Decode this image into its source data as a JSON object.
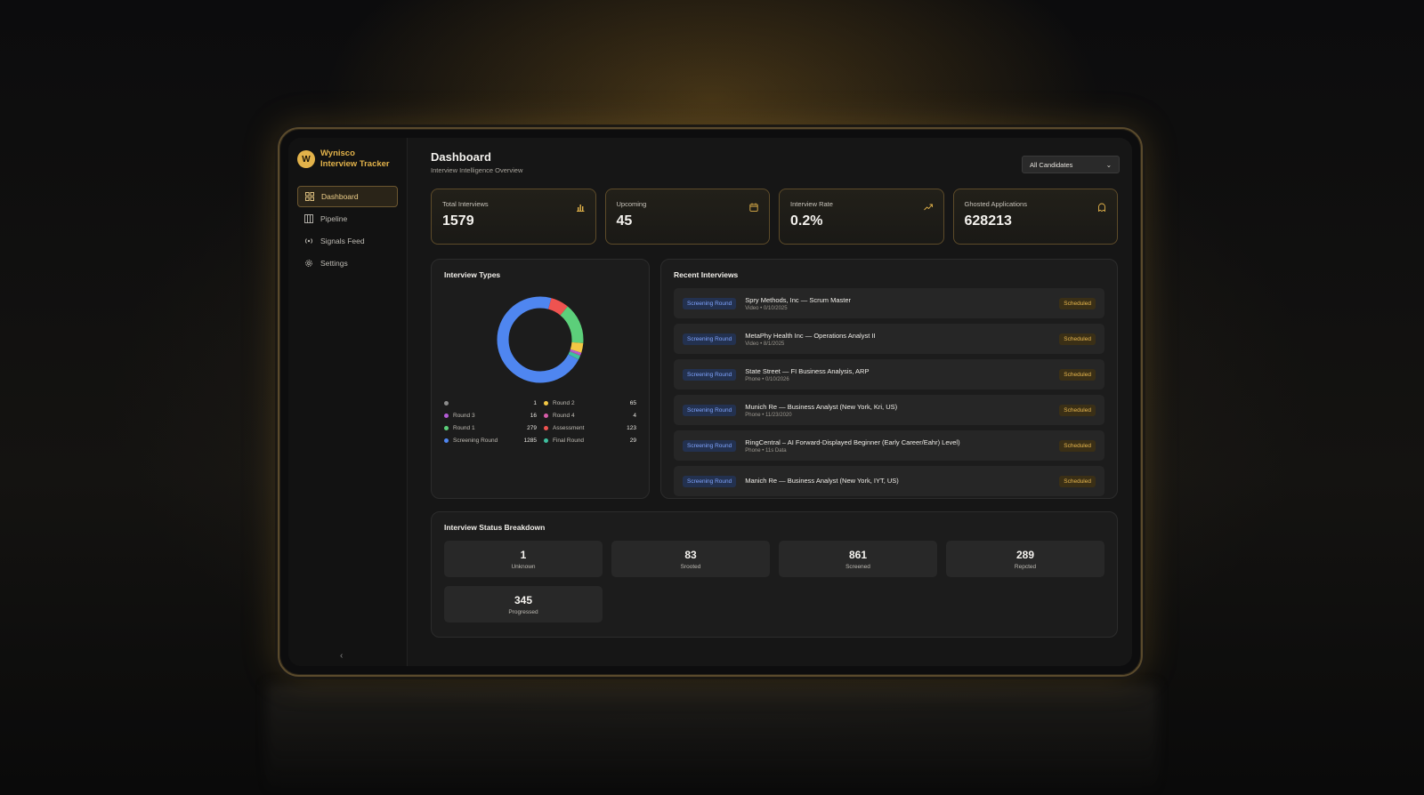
{
  "app": {
    "logo_letter": "W",
    "brand_line1": "Wynisco",
    "brand_line2": "Interview Tracker",
    "accent_color": "#e2b24a"
  },
  "sidebar": {
    "items": [
      {
        "label": "Dashboard",
        "icon": "grid-icon",
        "active": true
      },
      {
        "label": "Pipeline",
        "icon": "columns-icon",
        "active": false
      },
      {
        "label": "Signals Feed",
        "icon": "signal-icon",
        "active": false
      },
      {
        "label": "Settings",
        "icon": "gear-icon",
        "active": false
      }
    ],
    "collapse_glyph": "‹"
  },
  "header": {
    "title": "Dashboard",
    "subtitle": "Interview Intelligence Overview",
    "filter_value": "All Candidates"
  },
  "stats": [
    {
      "label": "Total Interviews",
      "value": "1579",
      "icon": "bar-chart-icon"
    },
    {
      "label": "Upcoming",
      "value": "45",
      "icon": "calendar-icon"
    },
    {
      "label": "Interview Rate",
      "value": "0.2%",
      "icon": "trend-up-icon"
    },
    {
      "label": "Ghosted Applications",
      "value": "628213",
      "icon": "ghost-icon"
    }
  ],
  "interview_types": {
    "title": "Interview Types",
    "items": [
      {
        "name": "",
        "value": 1,
        "color": "#8c8c8c"
      },
      {
        "name": "Round 2",
        "value": 65,
        "color": "#f2c744"
      },
      {
        "name": "Round 3",
        "value": 16,
        "color": "#b45cd6"
      },
      {
        "name": "Round 4",
        "value": 4,
        "color": "#d65ca8"
      },
      {
        "name": "Round 1",
        "value": 279,
        "color": "#5ccf7a"
      },
      {
        "name": "Assessment",
        "value": 123,
        "color": "#ef5350"
      },
      {
        "name": "Screening Round",
        "value": 1285,
        "color": "#4f86f0"
      },
      {
        "name": "Final Round",
        "value": 29,
        "color": "#3fbf9f"
      }
    ]
  },
  "recent": {
    "title": "Recent Interviews",
    "items": [
      {
        "round": "Screening Round",
        "title": "Spry Methods, Inc — Scrum Master",
        "meta": "Video • 0/10/2025",
        "status": "Scheduled"
      },
      {
        "round": "Screening Round",
        "title": "MetaPhy Health Inc — Operations Analyst II",
        "meta": "Video • 8/1/2025",
        "status": "Scheduled"
      },
      {
        "round": "Screening Round",
        "title": "State Street — FI Business Analysis, ARP",
        "meta": "Phone • 0/10/2026",
        "status": "Scheduled"
      },
      {
        "round": "Screening Round",
        "title": "Munich Re — Business Analyst (New York, Kri, US)",
        "meta": "Phone • 11/23/2020",
        "status": "Scheduled"
      },
      {
        "round": "Screening Round",
        "title": "RingCentral – AI Forward-Displayed Beginner (Early Career/Eahr) Level)",
        "meta": "Phone • 11s Data",
        "status": "Scheduled"
      },
      {
        "round": "Screening Round",
        "title": "Manich Re — Business Analyst (New York, IYT, US)",
        "meta": "",
        "status": "Scheduled"
      }
    ]
  },
  "breakdown": {
    "title": "Interview Status Breakdown",
    "items": [
      {
        "value": "1",
        "label": "Unknown"
      },
      {
        "value": "83",
        "label": "Srooted"
      },
      {
        "value": "861",
        "label": "Screened"
      },
      {
        "value": "289",
        "label": "Repcted"
      },
      {
        "value": "345",
        "label": "Progressed"
      }
    ]
  }
}
